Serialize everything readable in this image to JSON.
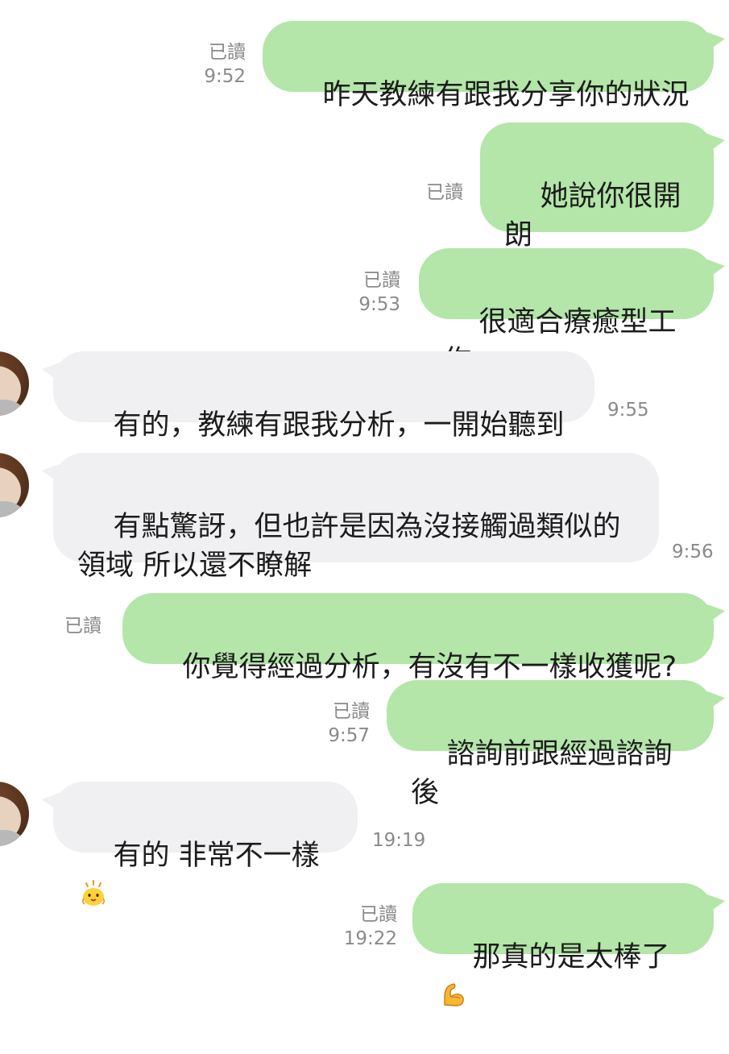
{
  "messages": [
    {
      "side": "out",
      "text": "昨天教練有跟我分享你的狀況",
      "read": "已讀",
      "time": "9:52"
    },
    {
      "side": "out",
      "text": "她說你很開朗\n樂於分享",
      "read": "已讀",
      "time": ""
    },
    {
      "side": "out",
      "text": "很適合療癒型工作",
      "read": "已讀",
      "time": "9:53"
    },
    {
      "side": "in",
      "text": "有的，教練有跟我分析，一開始聽到",
      "time": "9:55"
    },
    {
      "side": "in",
      "text": "有點驚訝，但也許是因為沒接觸過類似的\n領域 所以還不瞭解",
      "time": "9:56"
    },
    {
      "side": "out",
      "text": "你覺得經過分析，有沒有不一樣收獲呢?",
      "read": "已讀",
      "time": ""
    },
    {
      "side": "out",
      "text": "諮詢前跟經過諮詢後",
      "read": "已讀",
      "time": "9:57"
    },
    {
      "side": "in",
      "text": "有的 非常不一樣",
      "emoji": "smiling-chick-emoji",
      "time": "19:19"
    },
    {
      "side": "out",
      "text": "那真的是太棒了",
      "emoji": "flexed-biceps-emoji",
      "read": "已讀",
      "time": "19:22"
    }
  ],
  "colors": {
    "outgoing_bubble": "#b3e6a8",
    "incoming_bubble": "#f0f0f3",
    "meta_text": "#8a8a8a",
    "background": "#ffffff"
  }
}
